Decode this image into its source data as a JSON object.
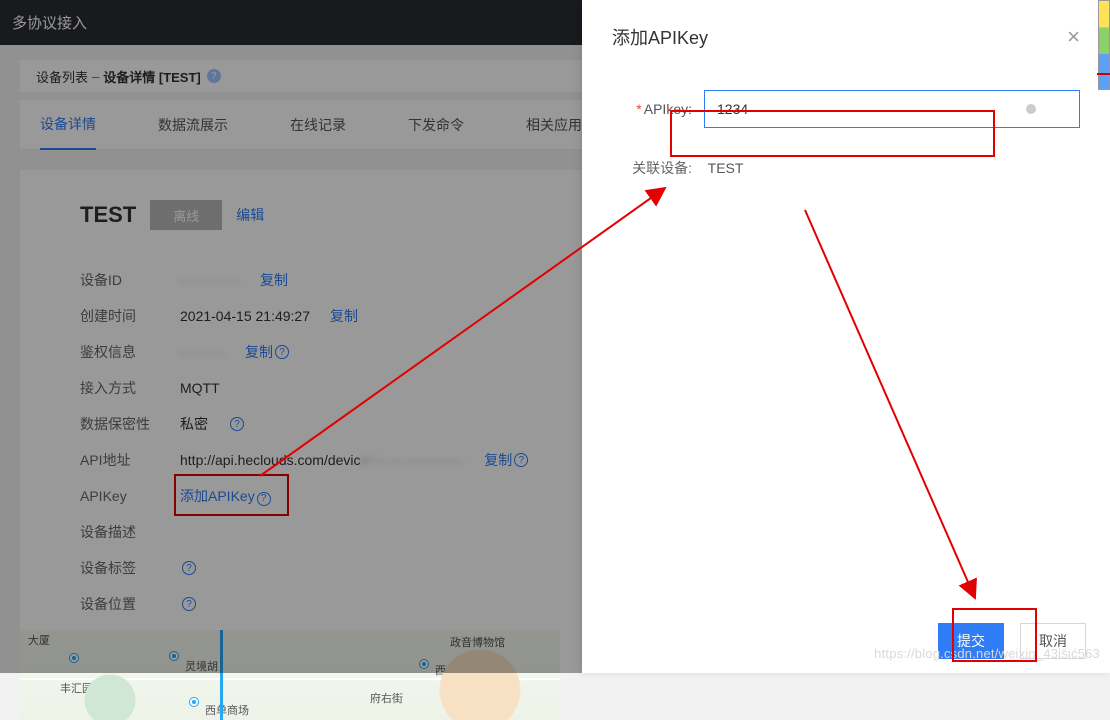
{
  "topbar": {
    "title": "多协议接入"
  },
  "breadcrumb": {
    "a": "设备列表",
    "sep": "–",
    "b": "设备详情 [TEST]"
  },
  "tabs": {
    "t0": "设备详情",
    "t1": "数据流展示",
    "t2": "在线记录",
    "t3": "下发命令",
    "t4": "相关应用"
  },
  "device": {
    "name": "TEST",
    "offline_label": "离线",
    "edit_label": "编辑",
    "rows": {
      "id_label": "设备ID",
      "id_value": "————",
      "ct_label": "创建时间",
      "ct_value": "2021-04-15 21:49:27",
      "auth_label": "鉴权信息",
      "auth_value": "———",
      "proto_label": "接入方式",
      "proto_value": "MQTT",
      "sec_label": "数据保密性",
      "sec_value": "私密",
      "api_label": "API地址",
      "api_value": "http://api.heclouds.com/devic",
      "key_label": "APIKey",
      "key_link": "添加APIKey",
      "desc_label": "设备描述",
      "tag_label": "设备标签",
      "loc_label": "设备位置"
    },
    "copy": "复制"
  },
  "map": {
    "l0": "大厦",
    "l1": "丰汇园小区",
    "l2": "灵境胡",
    "l3": "西单商场",
    "l4": "府右街",
    "l5": "西华门",
    "l6": "政音博物馆"
  },
  "panel": {
    "title": "添加APIKey",
    "apikey_label": "APIkey:",
    "apikey_value": "1234",
    "assoc_label": "关联设备:",
    "assoc_value": "TEST",
    "submit": "提交",
    "cancel": "取消"
  },
  "watermark": "https://blog.csdn.net/weixin_43išić563"
}
